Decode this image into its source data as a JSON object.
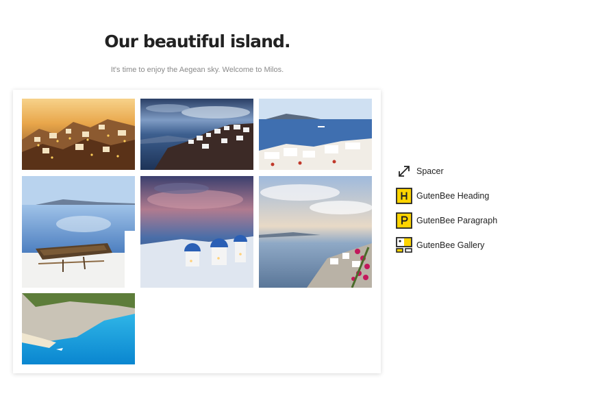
{
  "content": {
    "heading": "Our beautiful island.",
    "subtitle": "It's time to enjoy the Aegean sky. Welcome to Milos."
  },
  "gallery": {
    "images": [
      {
        "subject": "village-at-sunset"
      },
      {
        "subject": "cliffside-town-at-dusk"
      },
      {
        "subject": "terraces-over-the-sea"
      },
      {
        "subject": "old-wooden-boat"
      },
      {
        "subject": "blue-domed-churches"
      },
      {
        "subject": "coastline-with-flowers"
      },
      {
        "subject": "cove-with-turquoise-water"
      }
    ]
  },
  "blocks": {
    "items": [
      {
        "label": "Spacer",
        "icon": "spacer-icon"
      },
      {
        "label": "GutenBee Heading",
        "icon": "heading-block-icon"
      },
      {
        "label": "GutenBee Paragraph",
        "icon": "paragraph-block-icon"
      },
      {
        "label": "GutenBee Gallery",
        "icon": "gallery-block-icon"
      }
    ]
  },
  "colors": {
    "accent": "#ffd400",
    "text": "#222222",
    "muted": "#8a8a8a"
  }
}
